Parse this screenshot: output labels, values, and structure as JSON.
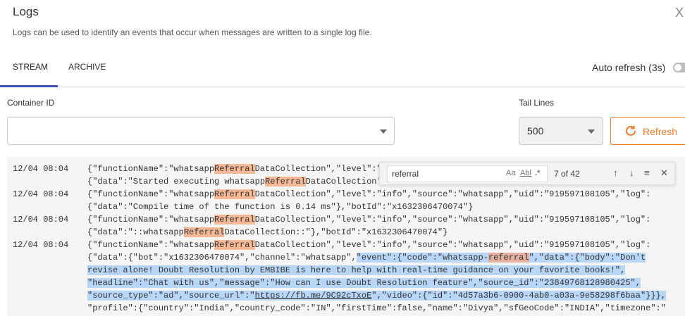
{
  "header": {
    "title": "Logs",
    "subtitle": "Logs can be used to identify an events that occur when messages are written to a single log file.",
    "close_symbol": "X"
  },
  "tabs": [
    {
      "label": "STREAM",
      "active": true
    },
    {
      "label": "ARCHIVE",
      "active": false
    }
  ],
  "auto_refresh": {
    "label": "Auto refresh (3s)",
    "enabled": false
  },
  "container": {
    "label": "Container ID",
    "value": ""
  },
  "tail": {
    "label": "Tail Lines",
    "value": "500"
  },
  "refresh_button": {
    "label": "Refresh"
  },
  "colors": {
    "accent": "#f0792a",
    "tab_indicator": "#3f51b5",
    "match": "#f6b997",
    "selection": "#b8d6f8"
  },
  "find": {
    "query": "referral",
    "match_case": "Aa",
    "whole_word": "Abl",
    "regex": ".*",
    "count": "7 of 42",
    "prev": "↑",
    "next": "↓",
    "in_selection": "≡",
    "close": "✕"
  },
  "logs": {
    "e1_ts": "12/04 08:04",
    "e1_l1_a": "{\"functionName\":\"whatsapp",
    "e1_l1_h": "Referral",
    "e1_l1_b": "DataCollection\",\"level\":\"",
    "e1_l2_a": "{\"data\":\"Started executing whatsapp",
    "e1_l2_h": "Referral",
    "e1_l2_b": "DataCollection'",
    "e2_ts": "12/04 08:04",
    "e2_l1_a": "{\"functionName\":\"whatsapp",
    "e2_l1_h": "Referral",
    "e2_l1_b": "DataCollection\",\"level\":\"info\",\"source\":\"whatsapp\",\"uid\":\"919597108105\",\"log\":",
    "e2_l2": "{\"data\":\"Compile time of the function is 0.14 ms\"},\"botId\":\"x1632306470074\"}",
    "e3_ts": "12/04 08:04",
    "e3_l1_a": "{\"functionName\":\"whatsapp",
    "e3_l1_h": "Referral",
    "e3_l1_b": "DataCollection\",\"level\":\"info\",\"source\":\"whatsapp\",\"uid\":\"919597108105\",\"log\":",
    "e3_l2_a": "{\"data\":\"::whatsapp",
    "e3_l2_h": "Referral",
    "e3_l2_b": "DataCollection::\"},\"botId\":\"x1632306470074\"}",
    "e4_ts": "12/04 08:04",
    "e4_l1_a": "{\"functionName\":\"whatsapp",
    "e4_l1_h": "Referral",
    "e4_l1_b": "DataCollection\",\"level\":\"info\",\"source\":\"whatsapp\",\"uid\":\"919597108105\",\"log\":",
    "e4_l2_a": "{\"data\":{\"bot\":\"x1632306470074\",\"channel\":\"whatsapp\",",
    "e4_l2_s1": "\"event\":{\"code\":\"whatsapp-",
    "e4_l2_h": "referral",
    "e4_l2_s2": "\",\"data\":{\"body\":\"Don't",
    "e4_l3": "revise alone! Doubt Resolution by EMBIBE is here to help with real-time guidance on your favorite books!\",",
    "e4_l4": "\"headline\":\"Chat with us\",\"message\":\"How can I use Doubt Resolution feature\",\"source_id\":\"23849768128980425\",",
    "e4_l5_a": "\"source_type\":\"ad\",\"source_url\":\"",
    "e4_l5_u": "https://fb.me/9C92cTxoE",
    "e4_l5_b": "\",\"video\":{\"id\":\"4d57a3b6-0900-4ab0-a03a-9e58298f6baa\"}}},",
    "e4_l6": "\"profile\":{\"country\":\"India\",\"country_code\":\"IN\",\"firstTime\":false,\"name\":\"Divya\",\"sfGeoCode\":\"INDIA\",\"timezone\":\""
  }
}
